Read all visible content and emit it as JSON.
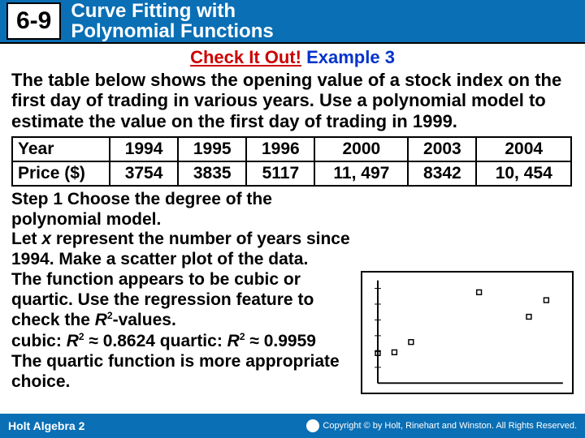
{
  "header": {
    "lesson_number": "6-9",
    "title_line1": "Curve Fitting with",
    "title_line2": "Polynomial Functions"
  },
  "check": {
    "red": "Check It Out!",
    "blue": "Example 3"
  },
  "problem": "The table below shows the opening value of a stock index on the first day of trading in various years. Use a polynomial model to estimate the value on the first day of trading in 1999.",
  "table": {
    "row1_label": "Year",
    "row1": [
      "1994",
      "1995",
      "1996",
      "2000",
      "2003",
      "2004"
    ],
    "row2_label": "Price ($)",
    "row2": [
      "3754",
      "3835",
      "5117",
      "11, 497",
      "8342",
      "10, 454"
    ]
  },
  "step": {
    "l1a": "Step 1",
    "l1b": " Choose the degree of the polynomial model.",
    "l2a": "Let ",
    "l2b": "x",
    "l2c": " represent the number of years since 1994. Make a scatter plot of the data.",
    "l3": "The function appears to be cubic or quartic. Use the regression feature to check the ",
    "l3r": "R",
    "l3sup": "2",
    "l3end": "-values.",
    "l4a": "cubic: ",
    "l4r1": "R",
    "l4s1": "2",
    "l4b": " ≈ 0.8624  quartic: ",
    "l4r2": "R",
    "l4s2": "2",
    "l4c": " ≈ 0.9959",
    "l5": "The quartic function is more appropriate choice."
  },
  "footer": {
    "left": "Holt Algebra 2",
    "right": "Copyright © by Holt, Rinehart and Winston. All Rights Reserved."
  },
  "chart_data": {
    "type": "scatter",
    "title": "",
    "xlabel": "",
    "ylabel": "",
    "x": [
      0,
      1,
      2,
      6,
      9,
      10
    ],
    "y": [
      3754,
      3835,
      5117,
      11497,
      8342,
      10454
    ],
    "xlim": [
      0,
      11
    ],
    "ylim": [
      0,
      13000
    ]
  }
}
